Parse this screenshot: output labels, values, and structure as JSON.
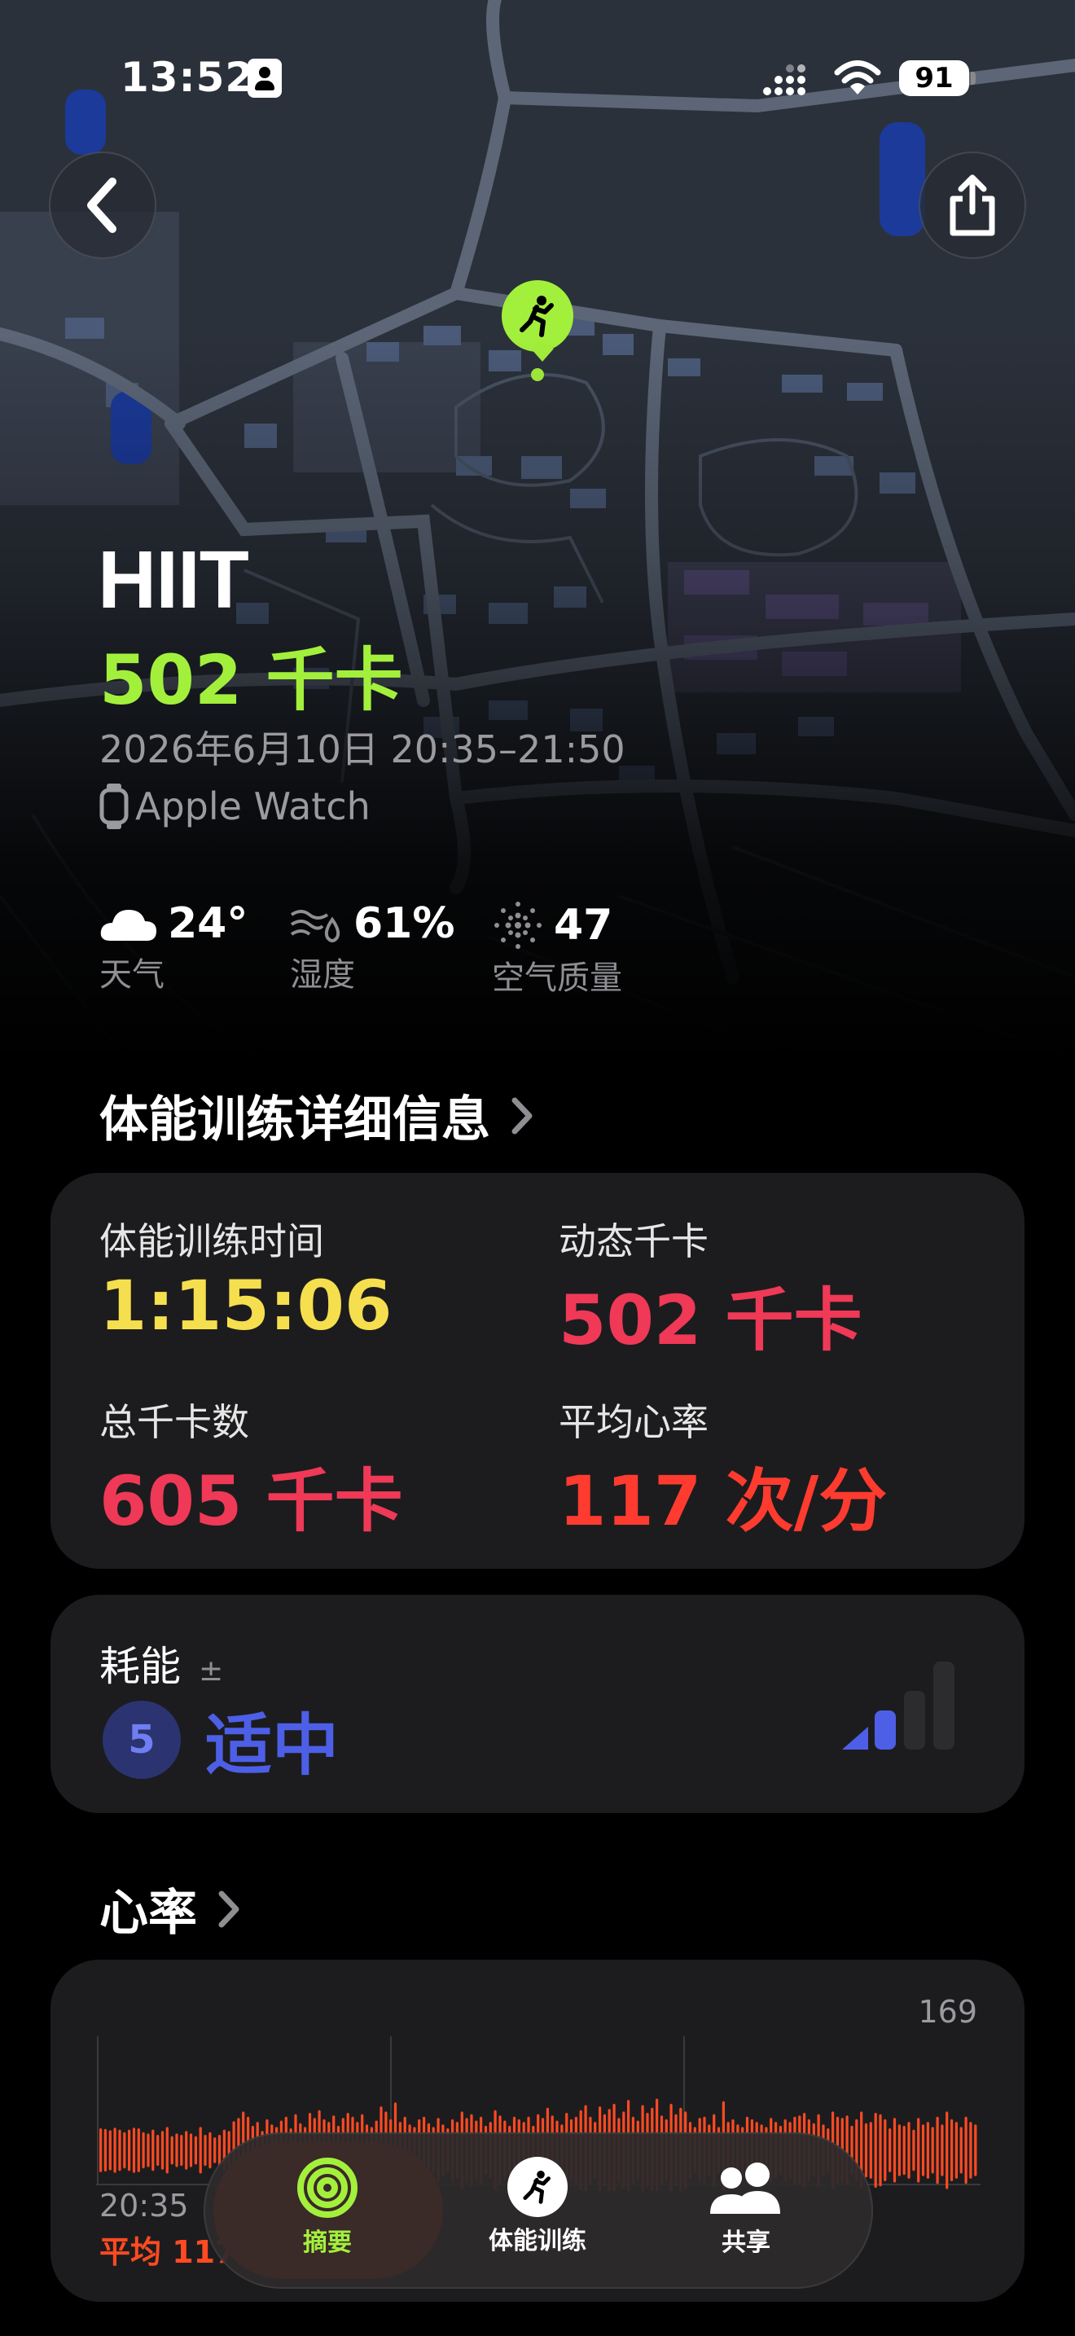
{
  "status_bar": {
    "time": "13:52",
    "battery": "91"
  },
  "header": {
    "activity": "HIIT",
    "calories": "502 千卡",
    "date_range": "2026年6月10日 20:35–21:50",
    "device": "Apple Watch"
  },
  "weather": [
    {
      "icon": "cloud-icon",
      "value": "24°",
      "label": "天气"
    },
    {
      "icon": "humidity-icon",
      "value": "61%",
      "label": "湿度"
    },
    {
      "icon": "air-quality-icon",
      "value": "47",
      "label": "空气质量"
    }
  ],
  "details": {
    "title": "体能训练详细信息",
    "metrics": [
      {
        "label": "体能训练时间",
        "value": "1:15:06",
        "color": "#f6df4e"
      },
      {
        "label": "动态千卡",
        "value": "502 千卡",
        "color": "#ef3957"
      },
      {
        "label": "总千卡数",
        "value": "605 千卡",
        "color": "#ef3957"
      },
      {
        "label": "平均心率",
        "value": "117 次/分",
        "color": "#ff3b30"
      }
    ]
  },
  "effort": {
    "label": "耗能",
    "symbol": "±",
    "number": "5",
    "level": "适中",
    "fraction": 0.5
  },
  "heart_rate": {
    "title": "心率",
    "max_label": "169",
    "start_time": "20:35",
    "avg_label": "平均 117",
    "color": "#ff4a22",
    "chart_data": {
      "type": "bar",
      "ylim": [
        60,
        169
      ],
      "values": [
        94,
        93,
        91,
        95,
        92,
        88,
        92,
        95,
        94,
        88,
        86,
        92,
        84,
        90,
        96,
        82,
        86,
        84,
        90,
        86,
        82,
        96,
        84,
        88,
        80,
        84,
        92,
        90,
        105,
        110,
        120,
        112,
        98,
        104,
        90,
        108,
        100,
        96,
        106,
        112,
        94,
        116,
        102,
        96,
        118,
        110,
        122,
        108,
        104,
        114,
        98,
        110,
        118,
        112,
        104,
        116,
        100,
        96,
        106,
        128,
        120,
        108,
        134,
        104,
        112,
        100,
        96,
        108,
        112,
        102,
        96,
        110,
        100,
        94,
        108,
        104,
        120,
        110,
        116,
        106,
        112,
        98,
        104,
        122,
        114,
        106,
        98,
        112,
        108,
        104,
        112,
        98,
        116,
        110,
        126,
        114,
        106,
        100,
        118,
        108,
        112,
        122,
        130,
        112,
        104,
        128,
        116,
        124,
        132,
        110,
        120,
        138,
        112,
        106,
        130,
        118,
        126,
        140,
        114,
        108,
        132,
        116,
        126,
        120,
        104,
        96,
        110,
        112,
        100,
        116,
        96,
        136,
        104,
        108,
        100,
        96,
        112,
        108,
        104,
        100,
        96,
        110,
        104,
        98,
        108,
        104,
        112,
        114,
        118,
        108,
        102,
        116,
        100,
        94,
        120,
        112,
        110,
        114,
        98,
        108,
        120,
        102,
        104,
        118,
        116,
        108,
        94,
        110,
        100,
        98,
        104,
        92,
        110,
        100,
        104,
        96,
        112,
        100,
        120,
        108,
        104,
        96,
        112,
        104,
        100
      ],
      "x_start": "20:35"
    }
  },
  "tabs": [
    {
      "label": "摘要",
      "icon": "activity-rings-icon",
      "active": true
    },
    {
      "label": "体能训练",
      "icon": "running-figure-icon",
      "active": false
    },
    {
      "label": "共享",
      "icon": "people-icon",
      "active": false
    }
  ],
  "colors": {
    "accent_green": "#a3f03c",
    "effort_blue": "#4d5fe6"
  }
}
